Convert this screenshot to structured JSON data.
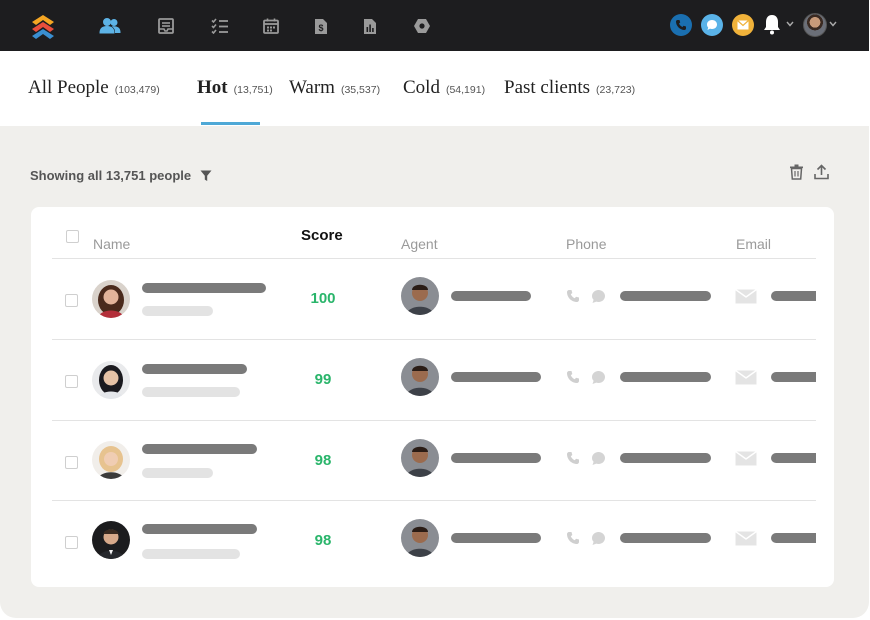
{
  "nav": {
    "icons": [
      "people-icon",
      "notes-icon",
      "tasks-icon",
      "calendar-icon",
      "deals-icon",
      "reports-icon",
      "settings-icon"
    ],
    "active": "people-icon",
    "quick_actions": [
      {
        "name": "phone",
        "color": "#1a6fb0"
      },
      {
        "name": "chat",
        "color": "#5ab3e8"
      },
      {
        "name": "email",
        "color": "#f0b23a"
      }
    ]
  },
  "tabs": [
    {
      "label": "All People",
      "count": "(103,479)"
    },
    {
      "label": "Hot",
      "count": "(13,751)",
      "active": true
    },
    {
      "label": "Warm",
      "count": "(35,537)"
    },
    {
      "label": "Cold",
      "count": "(54,191)"
    },
    {
      "label": "Past clients",
      "count": "(23,723)"
    }
  ],
  "toolbar": {
    "showing_text": "Showing all 13,751 people"
  },
  "table": {
    "columns": {
      "name": "Name",
      "score": "Score",
      "agent": "Agent",
      "phone": "Phone",
      "email": "Email"
    },
    "rows": [
      {
        "score": "100"
      },
      {
        "score": "99"
      },
      {
        "score": "98"
      },
      {
        "score": "98"
      }
    ]
  },
  "colors": {
    "accent": "#4ea8d6",
    "score_green": "#2ab56b",
    "topbar": "#1d1d1f"
  }
}
